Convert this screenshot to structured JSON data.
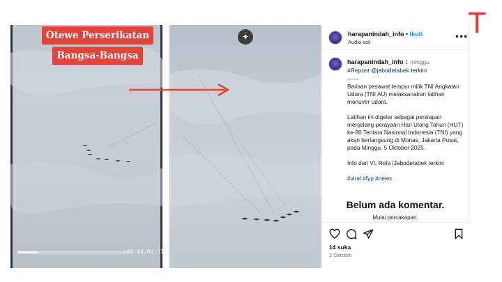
{
  "brand": {
    "logo_letter": "T",
    "color": "#e8392c"
  },
  "left_video": {
    "caption_line1": "Otewe Perserikatan",
    "caption_line2": "Bangsa-Bangsa",
    "timecode": "00:04/00:21",
    "progress_fraction": 0.19
  },
  "middle_photo": {
    "sparkle_icon": "sparkle-icon"
  },
  "post": {
    "username": "harapanindah_info",
    "separator": " • ",
    "follow_label": "Ikuti",
    "audio_label": "Audio asli",
    "time_ago": "1 minggu",
    "repost": "#Repost @jabodetabek terkini",
    "dash": "——",
    "para1": "Barisan pesawat tempur milik TNI Angkatan Udara (TNI AU) melaksanakan latihan manuver udara.",
    "para2": "Latihan ini digelar sebagai persiapan menjelang perayaan Hari Ulang Tahun (HUT) ke-80 Tentara Nasional Indonesia (TNI) yang akan berlangsung di Monas, Jakarta Pusat, pada Minggu, 5 Oktober 2025.",
    "para3": "Info dari Vt: Refa |Jabodetabek terkini",
    "tags": "#viral #fyp #news",
    "no_comments": "Belum ada komentar.",
    "start_conversation": "Mulai percakapan.",
    "likes": "14 suka",
    "date": "2 Oktober"
  }
}
